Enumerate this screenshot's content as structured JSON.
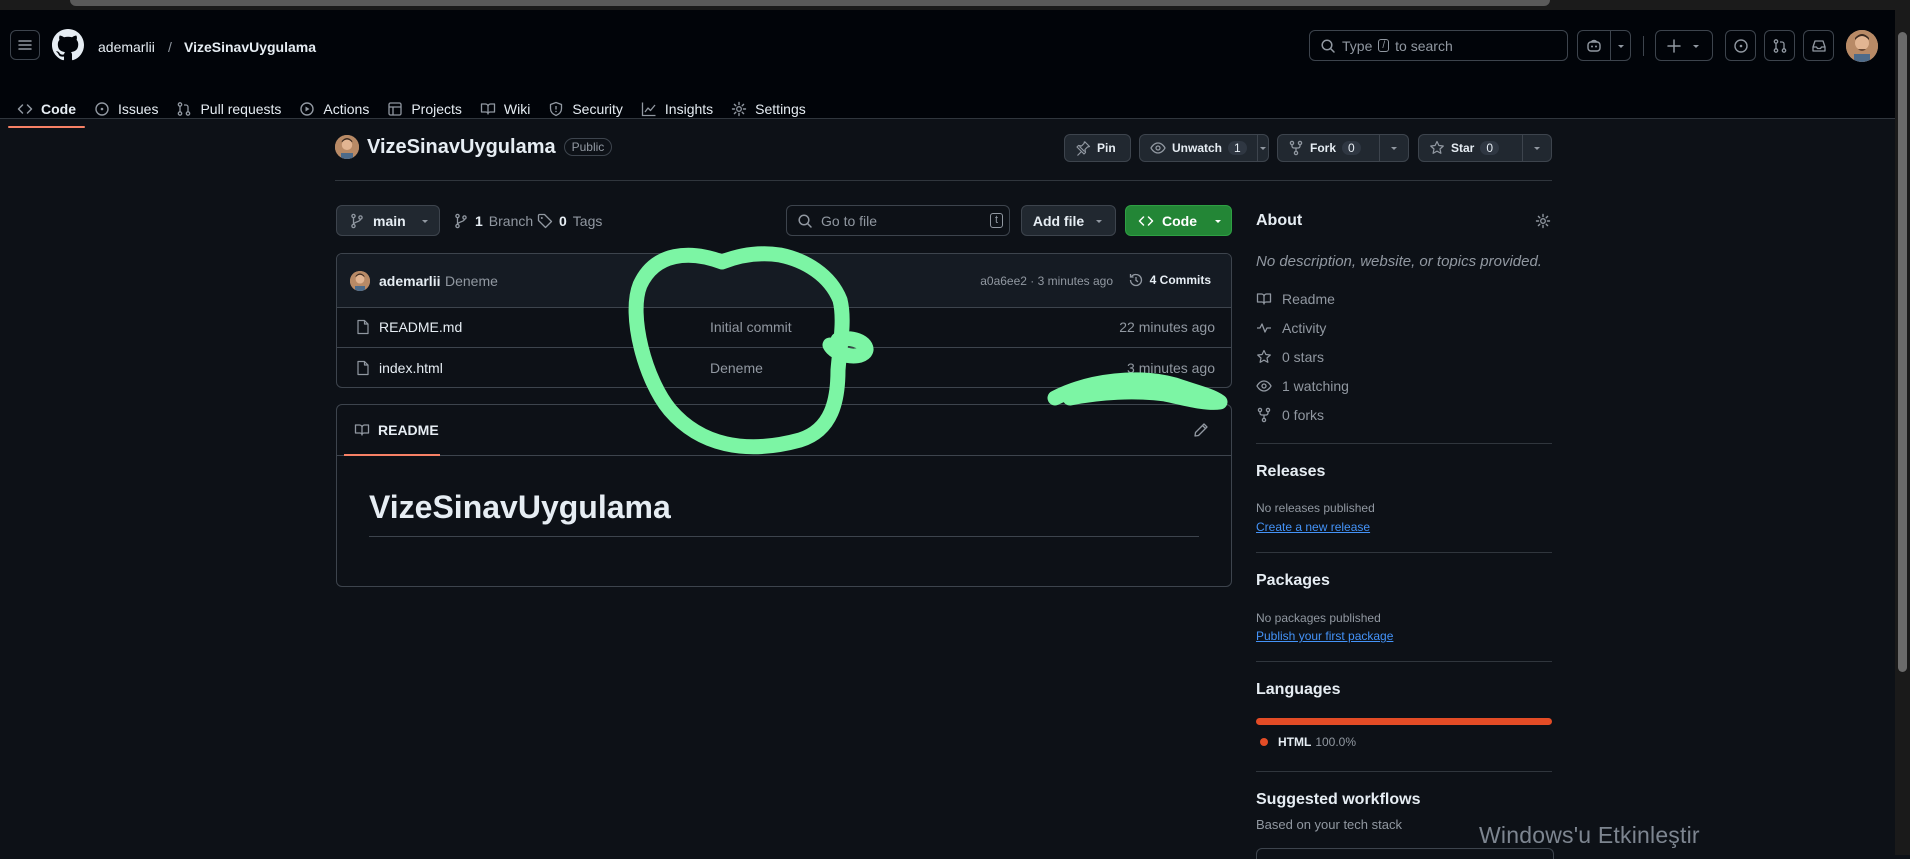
{
  "header": {
    "owner": "ademarlii",
    "separator": "/",
    "repo": "VizeSinavUygulama",
    "search_prefix": "Type",
    "search_key": "/",
    "search_suffix": "to search"
  },
  "tabs": [
    {
      "label": "Code",
      "icon": "code-icon",
      "selected": true
    },
    {
      "label": "Issues",
      "icon": "issue-icon"
    },
    {
      "label": "Pull requests",
      "icon": "pull-request-icon"
    },
    {
      "label": "Actions",
      "icon": "play-icon"
    },
    {
      "label": "Projects",
      "icon": "table-icon"
    },
    {
      "label": "Wiki",
      "icon": "book-icon"
    },
    {
      "label": "Security",
      "icon": "shield-icon"
    },
    {
      "label": "Insights",
      "icon": "graph-icon"
    },
    {
      "label": "Settings",
      "icon": "gear-icon"
    }
  ],
  "repo": {
    "name": "VizeSinavUygulama",
    "visibility": "Public",
    "pin": "Pin",
    "unwatch": "Unwatch",
    "watch_count": "1",
    "fork": "Fork",
    "fork_count": "0",
    "star": "Star",
    "star_count": "0"
  },
  "toolbar": {
    "branch": "main",
    "branch_count": "1",
    "branch_label": "Branch",
    "tag_count": "0",
    "tag_label": "Tags",
    "goto_placeholder": "Go to file",
    "goto_key": "t",
    "add_file": "Add file",
    "code": "Code"
  },
  "latest_commit": {
    "author": "ademarlii",
    "message": "Deneme",
    "hash_time": "a0a6ee2 · 3 minutes ago",
    "commits": "4 Commits"
  },
  "files": [
    {
      "name": "README.md",
      "message": "Initial commit",
      "age": "22 minutes ago"
    },
    {
      "name": "index.html",
      "message": "Deneme",
      "age": "3 minutes ago"
    }
  ],
  "readme": {
    "tab": "README",
    "heading": "VizeSinavUygulama"
  },
  "about": {
    "title": "About",
    "description": "No description, website, or topics provided.",
    "links": [
      {
        "label": "Readme",
        "icon": "book-icon"
      },
      {
        "label": "Activity",
        "icon": "pulse-icon"
      },
      {
        "label": "0 stars",
        "icon": "star-icon"
      },
      {
        "label": "1 watching",
        "icon": "eye-icon"
      },
      {
        "label": "0 forks",
        "icon": "fork-icon"
      }
    ]
  },
  "releases": {
    "title": "Releases",
    "empty": "No releases published",
    "link": "Create a new release"
  },
  "packages": {
    "title": "Packages",
    "empty": "No packages published",
    "link": "Publish your first package"
  },
  "languages": {
    "title": "Languages",
    "items": [
      {
        "name": "HTML",
        "percent": "100.0%",
        "color": "#e34c26",
        "share": 100
      }
    ]
  },
  "workflows": {
    "title": "Suggested workflows",
    "subtitle": "Based on your tech stack"
  },
  "watermark": "Windows'u Etkinleştir",
  "colors": {
    "bg": "#0d1117",
    "header_bg": "#010409",
    "border": "#3d444d",
    "accent_tab": "#f78166",
    "code_button": "#238636",
    "link": "#4493f8",
    "annotation": "#7cf5a4"
  }
}
